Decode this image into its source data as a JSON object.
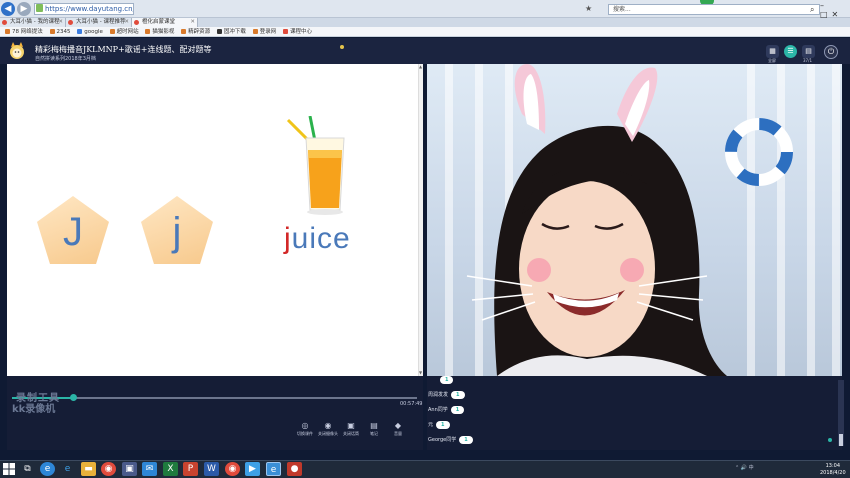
{
  "browser": {
    "url": "https://www.dayutang.cn/study/learning/k...",
    "search_placeholder": "搜索...",
    "tabs": [
      {
        "label": "大耳小猫 - 我的课程"
      },
      {
        "label": "大耳小猫 - 课程推荐"
      },
      {
        "label": "橙化启蒙课堂"
      }
    ],
    "bookmarks": [
      "78 网络提法",
      "2345",
      "google",
      "超时网站",
      "猫猫影视",
      "精辟资源",
      "固冲下载",
      "登录网",
      "课程中心"
    ]
  },
  "app": {
    "course_title": "精彩梅梅播音JKLMNP+歌谣+连线题、配对题等",
    "course_subtitle": "自然拼读系列2018年3月档",
    "header_buttons": [
      {
        "icon": "grid-icon",
        "label": "全屏"
      },
      {
        "icon": "list-icon",
        "label": "37/1"
      }
    ],
    "power_label": "退出"
  },
  "slide": {
    "pentagon_letters": [
      "J",
      "j"
    ],
    "word_first": "j",
    "word_rest": "uice"
  },
  "player": {
    "watermark_line1": "录制工具",
    "watermark_line2": "kk录像机",
    "time": "00:57:49",
    "progress": 0.15,
    "controls": [
      {
        "icon": "play-icon",
        "label": "切换课件"
      },
      {
        "icon": "camera-icon",
        "label": "关闭摄像头"
      },
      {
        "icon": "mic-icon",
        "label": "关闭话筒"
      },
      {
        "icon": "doc-icon",
        "label": "笔记"
      },
      {
        "icon": "speaker-icon",
        "label": "音量"
      }
    ]
  },
  "chat": {
    "messages": [
      {
        "user": "",
        "reply": "1"
      },
      {
        "user": "周润发发",
        "reply": "1"
      },
      {
        "user": "Ann同学",
        "reply": "1"
      },
      {
        "user": "元",
        "reply": "1"
      },
      {
        "user": "George同学",
        "reply": "1"
      }
    ]
  },
  "taskbar": {
    "tray": "⌃ 🔊 中",
    "time": "13:04",
    "date": "2018/4/20"
  }
}
